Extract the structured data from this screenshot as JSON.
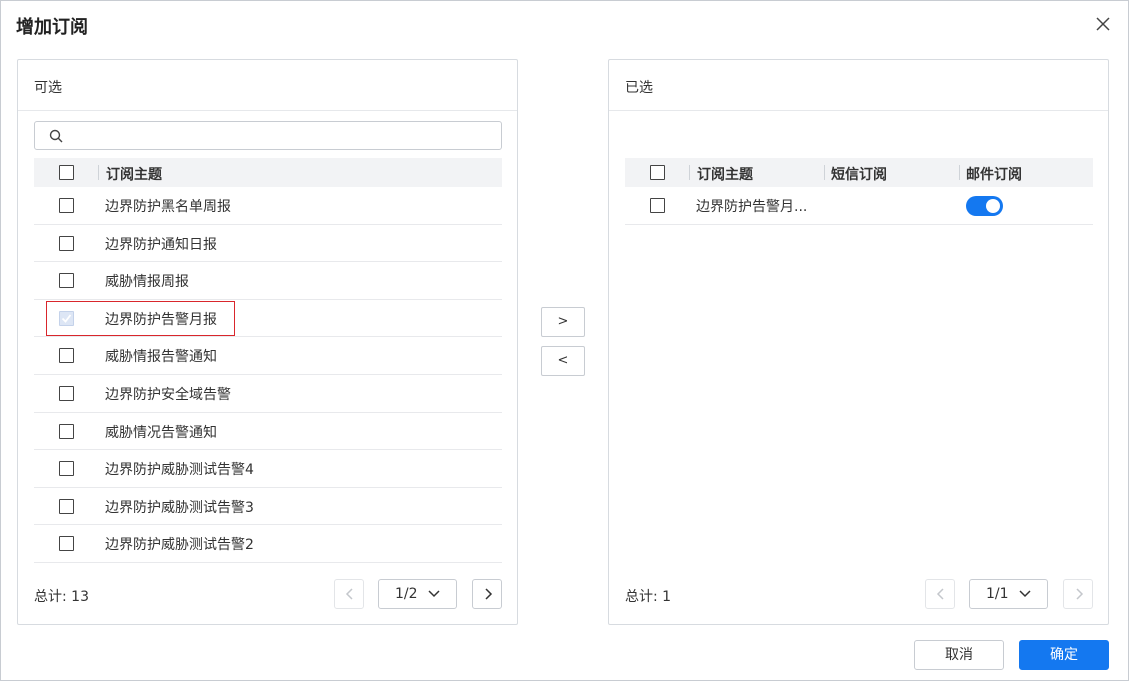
{
  "dialog": {
    "title": "增加订阅",
    "close_icon": "close-icon"
  },
  "left_panel": {
    "title": "可选",
    "search": {
      "value": "",
      "placeholder": ""
    },
    "header": {
      "topic": "订阅主题"
    },
    "rows": [
      {
        "label": "边界防护黑名单周报",
        "checked": false,
        "disabled": false
      },
      {
        "label": "边界防护通知日报",
        "checked": false,
        "disabled": false
      },
      {
        "label": "威胁情报周报",
        "checked": false,
        "disabled": false
      },
      {
        "label": "边界防护告警月报",
        "checked": true,
        "disabled": true
      },
      {
        "label": "威胁情报告警通知",
        "checked": false,
        "disabled": false
      },
      {
        "label": "边界防护安全域告警",
        "checked": false,
        "disabled": false
      },
      {
        "label": "威胁情况告警通知",
        "checked": false,
        "disabled": false
      },
      {
        "label": "边界防护威胁测试告警4",
        "checked": false,
        "disabled": false
      },
      {
        "label": "边界防护威胁测试告警3",
        "checked": false,
        "disabled": false
      },
      {
        "label": "边界防护威胁测试告警2",
        "checked": false,
        "disabled": false
      }
    ],
    "total": "总计: 13",
    "page": "1/2"
  },
  "transfer": {
    "to_right": ">",
    "to_left": "<"
  },
  "right_panel": {
    "title": "已选",
    "header": {
      "topic": "订阅主题",
      "sms": "短信订阅",
      "email": "邮件订阅"
    },
    "rows": [
      {
        "label": "边界防护告警月...",
        "email_enabled": true
      }
    ],
    "total": "总计: 1",
    "page": "1/1"
  },
  "footer": {
    "cancel": "取消",
    "ok": "确定"
  },
  "colors": {
    "primary": "#1478f0",
    "highlight": "#d9262c"
  }
}
